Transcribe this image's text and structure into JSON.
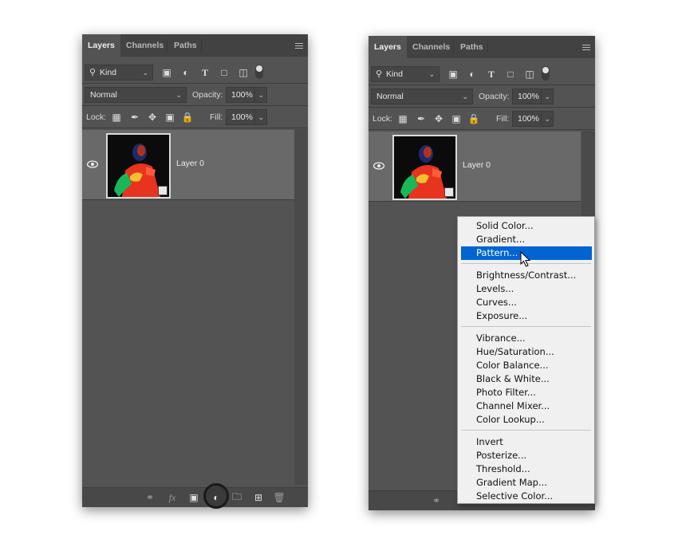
{
  "left_panel": {
    "tabs": [
      "Layers",
      "Channels",
      "Paths"
    ],
    "filter_kind": "Kind",
    "blend_mode": "Normal",
    "opacity_label": "Opacity:",
    "opacity_value": "100%",
    "lock_label": "Lock:",
    "fill_label": "Fill:",
    "fill_value": "100%",
    "layer_name": "Layer 0"
  },
  "right_panel": {
    "tabs": [
      "Layers",
      "Channels",
      "Paths"
    ],
    "filter_kind": "Kind",
    "blend_mode": "Normal",
    "opacity_label": "Opacity:",
    "opacity_value": "100%",
    "lock_label": "Lock:",
    "fill_label": "Fill:",
    "fill_value": "100%",
    "layer_name": "Layer 0"
  },
  "adjustment_menu": {
    "selected": "Pattern...",
    "groups": [
      [
        "Solid Color...",
        "Gradient...",
        "Pattern..."
      ],
      [
        "Brightness/Contrast...",
        "Levels...",
        "Curves...",
        "Exposure..."
      ],
      [
        "Vibrance...",
        "Hue/Saturation...",
        "Color Balance...",
        "Black & White...",
        "Photo Filter...",
        "Channel Mixer...",
        "Color Lookup..."
      ],
      [
        "Invert",
        "Posterize...",
        "Threshold...",
        "Gradient Map...",
        "Selective Color..."
      ]
    ]
  },
  "icons": [
    "search-icon",
    "image-filter-icon",
    "adjustment-filter-icon",
    "type-filter-icon",
    "shape-filter-icon",
    "smart-object-filter-icon",
    "filter-toggle-icon",
    "lock-pixels-icon",
    "lock-brush-icon",
    "lock-position-icon",
    "lock-artboard-icon",
    "lock-all-icon",
    "eye-icon",
    "link-icon",
    "fx-icon",
    "mask-icon",
    "adjustment-layer-icon",
    "folder-icon",
    "new-layer-icon",
    "trash-icon",
    "pointer-cursor-icon"
  ],
  "colors": {
    "panel_bg": "#535353",
    "selected_layer": "#696969",
    "menu_highlight": "#0064d2"
  }
}
